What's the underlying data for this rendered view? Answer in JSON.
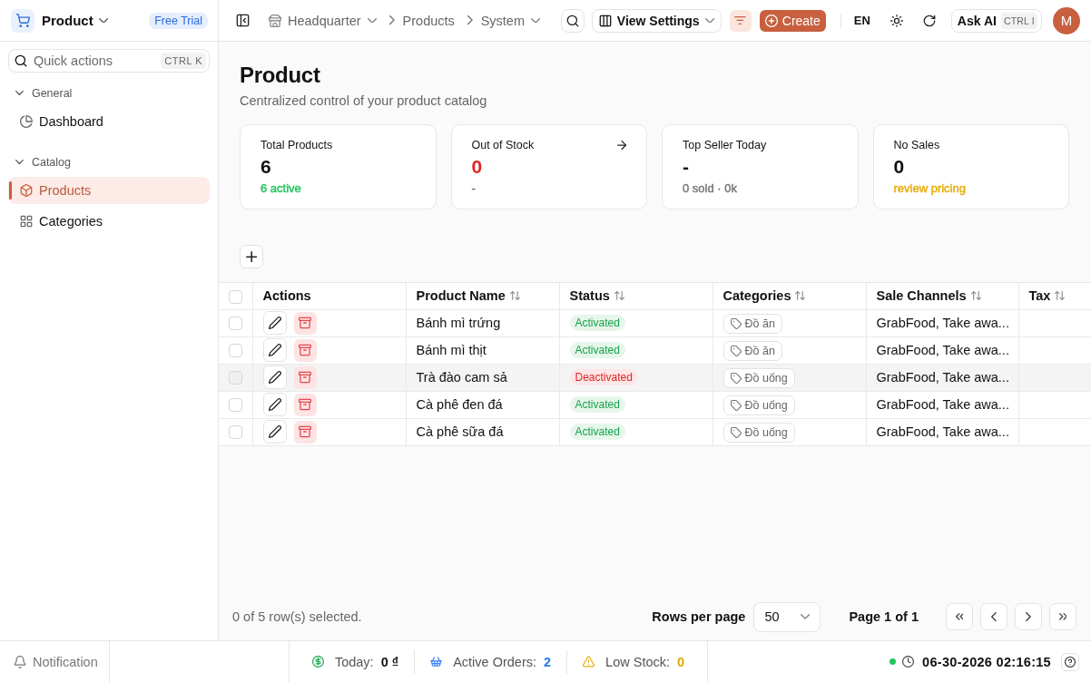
{
  "app": {
    "name": "Product",
    "badge": "Free Trial"
  },
  "sidebar": {
    "search": {
      "placeholder": "Quick actions",
      "shortcut": "CTRL K"
    },
    "sections": [
      {
        "label": "General",
        "expanded": true,
        "items": [
          {
            "label": "Dashboard",
            "kind": "dashboard",
            "selected": false
          }
        ]
      },
      {
        "label": "Catalog",
        "expanded": true,
        "items": [
          {
            "label": "Products",
            "kind": "products",
            "selected": true
          },
          {
            "label": "Categories",
            "kind": "categories",
            "selected": false
          }
        ]
      }
    ]
  },
  "header": {
    "breadcrumb": [
      {
        "label": "Headquarter",
        "kind": "location",
        "dropdown": true
      },
      {
        "label": "Products",
        "kind": "page",
        "dropdown": false
      },
      {
        "label": "System",
        "kind": "page",
        "dropdown": true
      }
    ],
    "view_settings": "View Settings",
    "filter_active": true,
    "create": "Create",
    "language": "EN",
    "ask_ai": {
      "label": "Ask AI",
      "shortcut": "CTRL I"
    },
    "avatar": "M"
  },
  "page": {
    "title": "Product",
    "subtitle": "Centralized control of your product catalog"
  },
  "stats": [
    {
      "label": "Total Products",
      "value": {
        "text": "6",
        "color": "#111111"
      },
      "note": {
        "text": "6 active",
        "color": "#22c55e"
      },
      "link": false
    },
    {
      "label": "Out of Stock",
      "value": {
        "text": "0",
        "color": "#dc2626"
      },
      "note": {
        "text": "-",
        "color": "#777777"
      },
      "link": true
    },
    {
      "label": "Top Seller Today",
      "value": {
        "text": "-",
        "color": "#111111"
      },
      "note": {
        "text": "0 sold · 0k",
        "color": "#777777"
      },
      "link": false
    },
    {
      "label": "No Sales",
      "value": {
        "text": "0",
        "color": "#111111"
      },
      "note": {
        "text": "review pricing",
        "color": "#e5ad0a"
      },
      "link": false
    }
  ],
  "table": {
    "select_all_checked": false,
    "columns": [
      {
        "label": "Actions",
        "sortable": false
      },
      {
        "label": "Product Name",
        "sortable": true
      },
      {
        "label": "Status",
        "sortable": true
      },
      {
        "label": "Categories",
        "sortable": true
      },
      {
        "label": "Sale Channels",
        "sortable": true
      },
      {
        "label": "Tax",
        "sortable": true
      }
    ],
    "rows": [
      {
        "checked": false,
        "hovered": false,
        "name": "Bánh mì trứng",
        "status": {
          "label": "Activated",
          "active": true
        },
        "category": "Đồ ăn",
        "channels": "GrabFood, Take awa..."
      },
      {
        "checked": false,
        "hovered": false,
        "name": "Bánh mì thịt",
        "status": {
          "label": "Activated",
          "active": true
        },
        "category": "Đồ ăn",
        "channels": "GrabFood, Take awa..."
      },
      {
        "checked": false,
        "hovered": true,
        "name": "Trà đào cam sả",
        "status": {
          "label": "Deactivated",
          "active": false
        },
        "category": "Đồ uống",
        "channels": "GrabFood, Take awa..."
      },
      {
        "checked": false,
        "hovered": false,
        "name": "Cà phê đen đá",
        "status": {
          "label": "Activated",
          "active": true
        },
        "category": "Đồ uống",
        "channels": "GrabFood, Take awa..."
      },
      {
        "checked": false,
        "hovered": false,
        "name": "Cà phê sữa đá",
        "status": {
          "label": "Activated",
          "active": true
        },
        "category": "Đồ uống",
        "channels": "GrabFood, Take awa..."
      }
    ]
  },
  "footer": {
    "selection": "0 of 5 row(s) selected.",
    "rows_per_page_label": "Rows per page",
    "rows_per_page": "50",
    "page": "Page 1 of 1"
  },
  "status_bar": {
    "notification": "Notification",
    "metrics": [
      {
        "kind": "revenue",
        "label": "Today:",
        "value": {
          "text": "0 ₫",
          "color": "#111111"
        }
      },
      {
        "kind": "orders",
        "label": "Active Orders:",
        "value": {
          "text": "2",
          "color": "#2b7de9"
        }
      },
      {
        "kind": "stock",
        "label": "Low Stock:",
        "value": {
          "text": "0",
          "color": "#e0a800"
        }
      }
    ],
    "online": true,
    "datetime": "06-30-2026 02:16:15"
  }
}
